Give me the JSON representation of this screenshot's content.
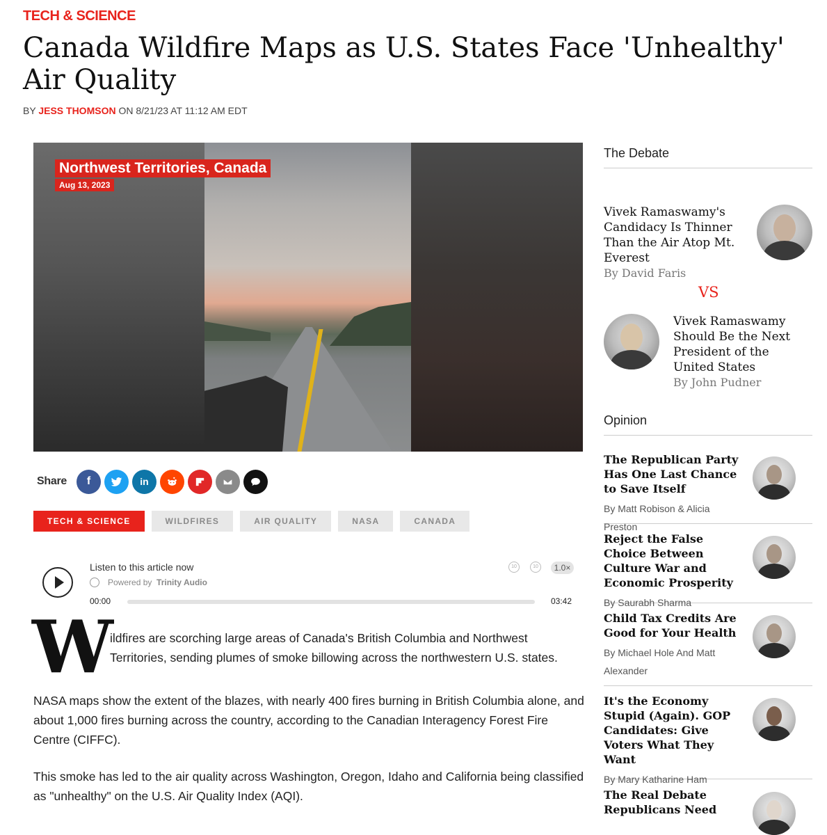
{
  "article": {
    "category": "TECH & SCIENCE",
    "headline": "Canada Wildfire Maps as U.S. States Face 'Unhealthy' Air Quality",
    "byline_prefix": "BY",
    "author": "JESS THOMSON",
    "byline_date": "ON 8/21/23 AT 11:12 AM EDT"
  },
  "hero": {
    "overlay_title": "Northwest Territories, Canada",
    "overlay_date": "Aug 13, 2023"
  },
  "share": {
    "label": "Share",
    "buttons": [
      {
        "icon": "facebook-icon",
        "glyph": "f",
        "color": "#3b5998"
      },
      {
        "icon": "twitter-icon",
        "glyph": "t",
        "color": "#1da1f2"
      },
      {
        "icon": "linkedin-icon",
        "glyph": "in",
        "color": "#0e76a8"
      },
      {
        "icon": "reddit-icon",
        "glyph": "r",
        "color": "#ff4500"
      },
      {
        "icon": "flipboard-icon",
        "glyph": "F",
        "color": "#e12828"
      },
      {
        "icon": "email-icon",
        "glyph": "✉",
        "color": "#8a8a8a"
      },
      {
        "icon": "comment-icon",
        "glyph": "●",
        "color": "#111111"
      }
    ]
  },
  "tags": [
    "TECH & SCIENCE",
    "WILDFIRES",
    "AIR QUALITY",
    "NASA",
    "CANADA"
  ],
  "audio": {
    "listen": "Listen to this article now",
    "powered_by": "Powered by",
    "provider": "Trinity Audio",
    "speed": "1.0×",
    "current_time": "00:00",
    "duration": "03:42",
    "skip_back": "10",
    "skip_forward": "10",
    "progress": 0
  },
  "body": {
    "dropcap": "W",
    "p1": "ildfires are scorching large areas of Canada's British Columbia and Northwest Territories, sending plumes of smoke billowing across the northwestern U.S. states.",
    "p2": "NASA maps show the extent of the blazes, with nearly 400 fires burning in British Columbia alone, and about 1,000 fires burning across the country, according to the Canadian Interagency Forest Fire Centre (CIFFC).",
    "p3": "This smoke has led to the air quality across Washington, Oregon, Idaho and California being classified as \"unhealthy\" on the U.S. Air Quality Index (AQI)."
  },
  "debate": {
    "heading": "The Debate",
    "vs": "VS",
    "a": {
      "title": "Vivek Ramaswamy's Candidacy Is Thinner Than the Air Atop Mt. Everest",
      "by": "By David Faris"
    },
    "b": {
      "title": "Vivek Ramaswamy Should Be the Next President of the United States",
      "by": "By John Pudner"
    }
  },
  "opinion": {
    "heading": "Opinion",
    "items": [
      {
        "title": "The Republican Party Has One Last Chance to Save Itself",
        "by": "By Matt Robison & Alicia Preston"
      },
      {
        "title": "Reject the False Choice Between Culture War and Economic Prosperity",
        "by": "By Saurabh Sharma"
      },
      {
        "title": "Child Tax Credits Are Good for Your Health",
        "by": "By Michael Hole And Matt Alexander"
      },
      {
        "title": "It's the Economy Stupid (Again). GOP Candidates: Give Voters What They Want",
        "by": "By Mary Katharine Ham"
      },
      {
        "title": "The Real Debate Republicans Need",
        "by": ""
      }
    ]
  },
  "colors": {
    "accent": "#e8231c"
  }
}
